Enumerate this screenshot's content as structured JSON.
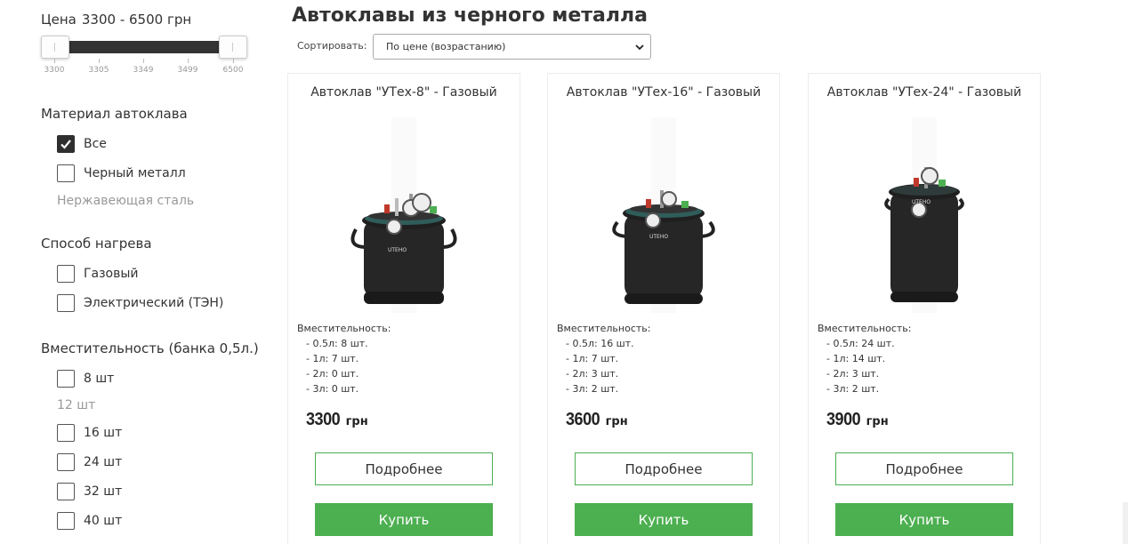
{
  "sidebar": {
    "price": {
      "label": "Цена",
      "range": "3300 - 6500 грн",
      "min": 3300,
      "max": 6500,
      "selected_min": 3300,
      "selected_max": 6500,
      "ticks": [
        "3300",
        "3305",
        "3349",
        "3499",
        "6500"
      ]
    },
    "material": {
      "title": "Материал автоклава",
      "options": [
        {
          "label": "Все",
          "checked": true
        },
        {
          "label": "Черный металл",
          "checked": false
        },
        {
          "label": "Нержавеющая сталь",
          "disabled": true
        }
      ]
    },
    "heating": {
      "title": "Способ нагрева",
      "options": [
        {
          "label": "Газовый",
          "checked": false
        },
        {
          "label": "Электрический (ТЭН)",
          "checked": false
        }
      ]
    },
    "capacity": {
      "title": "Вместительность (банка 0,5л.)",
      "options": [
        {
          "label": "8 шт",
          "checked": false
        },
        {
          "label": "12 шт",
          "disabled": true
        },
        {
          "label": "16 шт",
          "checked": false
        },
        {
          "label": "24 шт",
          "checked": false
        },
        {
          "label": "32 шт",
          "checked": false
        },
        {
          "label": "40 шт",
          "checked": false
        }
      ]
    }
  },
  "main": {
    "title": "Автоклавы из черного металла",
    "sort_label": "Сортировать:",
    "sort_value": "По цене (возрастанию)"
  },
  "products": [
    {
      "title": "Автоклав \"УТех-8\" - Газовый",
      "specs_title": "Вместительность:",
      "specs": [
        "- 0.5л: 8 шт.",
        "- 1л: 7 шт.",
        "- 2л: 0 шт.",
        "- 3л: 0 шт."
      ],
      "price": "3300",
      "currency": "грн",
      "more_label": "Подробнее",
      "buy_label": "Купить",
      "brand": "UTEHO",
      "image_icon": "autoclave-small-icon"
    },
    {
      "title": "Автоклав \"УТех-16\" - Газовый",
      "specs_title": "Вместительность:",
      "specs": [
        "- 0.5л: 16 шт.",
        "- 1л: 7 шт.",
        "- 2л: 3 шт.",
        "- 3л: 2 шт."
      ],
      "price": "3600",
      "currency": "грн",
      "more_label": "Подробнее",
      "buy_label": "Купить",
      "brand": "UTEHO",
      "image_icon": "autoclave-medium-icon"
    },
    {
      "title": "Автоклав \"УТех-24\" - Газовый",
      "specs_title": "Вместительность:",
      "specs": [
        "- 0.5л: 24 шт.",
        "- 1л: 14 шт.",
        "- 2л: 3 шт.",
        "- 3л: 2 шт."
      ],
      "price": "3900",
      "currency": "грн",
      "more_label": "Подробнее",
      "buy_label": "Купить",
      "brand": "UTEHO",
      "image_icon": "autoclave-large-icon"
    }
  ],
  "colors": {
    "accent": "#4caf50",
    "text": "#333333",
    "muted": "#999999",
    "slider_fill": "#333333"
  }
}
